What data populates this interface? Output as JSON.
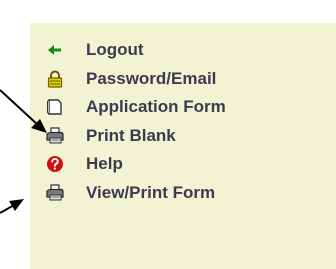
{
  "menu": {
    "items": [
      {
        "label": "Logout",
        "icon": "back-arrow-icon",
        "color": "#1a8a1a"
      },
      {
        "label": "Password/Email",
        "icon": "padlock-icon",
        "color": "#d8c200"
      },
      {
        "label": "Application Form",
        "icon": "blank-page-icon",
        "color": "#555555"
      },
      {
        "label": "Print Blank",
        "icon": "printer-icon",
        "color": "#444444"
      },
      {
        "label": "Help",
        "icon": "help-icon",
        "color": "#cc1111"
      },
      {
        "label": "View/Print Form",
        "icon": "printer-icon",
        "color": "#444444"
      }
    ]
  },
  "colors": {
    "panel_background": "#f2f3d3",
    "label_text": "#3b3b4f",
    "annotation_arrow": "#000000"
  }
}
